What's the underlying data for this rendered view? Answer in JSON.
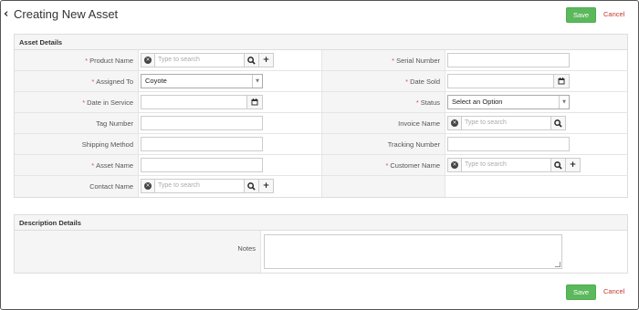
{
  "header": {
    "title": "Creating New Asset",
    "save_label": "Save",
    "cancel_label": "Cancel"
  },
  "asset_details": {
    "title": "Asset Details",
    "product_name": {
      "label": "Product Name",
      "placeholder": "Type to search"
    },
    "serial_number": {
      "label": "Serial Number",
      "value": ""
    },
    "assigned_to": {
      "label": "Assigned To",
      "value": "Coyote"
    },
    "date_sold": {
      "label": "Date Sold",
      "value": ""
    },
    "date_in_service": {
      "label": "Date in Service",
      "value": ""
    },
    "status": {
      "label": "Status",
      "value": "Select an Option"
    },
    "tag_number": {
      "label": "Tag Number",
      "value": ""
    },
    "invoice_name": {
      "label": "Invoice Name",
      "placeholder": "Type to search"
    },
    "shipping_method": {
      "label": "Shipping Method",
      "value": ""
    },
    "tracking_number": {
      "label": "Tracking Number",
      "value": ""
    },
    "asset_name": {
      "label": "Asset Name",
      "value": ""
    },
    "customer_name": {
      "label": "Customer Name",
      "placeholder": "Type to search"
    },
    "contact_name": {
      "label": "Contact Name",
      "placeholder": "Type to search"
    }
  },
  "description_details": {
    "title": "Description Details",
    "notes": {
      "label": "Notes",
      "value": ""
    }
  },
  "footer": {
    "save_label": "Save",
    "cancel_label": "Cancel"
  },
  "colors": {
    "save_button": "#5cb85c",
    "cancel_link": "#c0392b",
    "required_mark": "#d9534f"
  }
}
